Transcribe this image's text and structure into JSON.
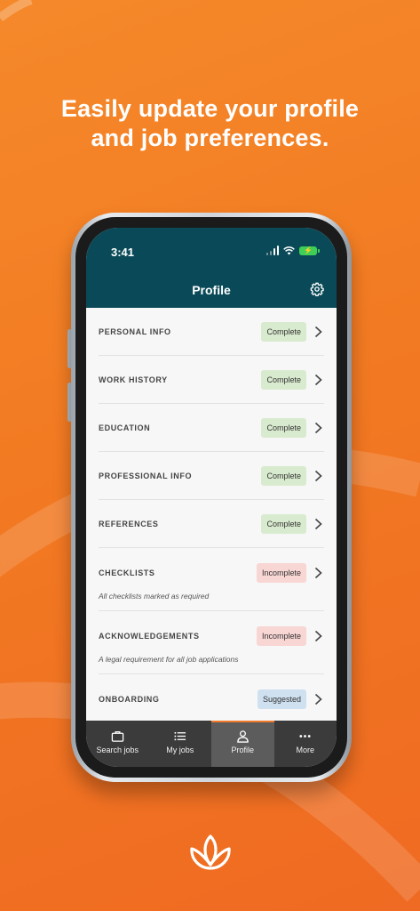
{
  "headline": {
    "line1": "Easily update your profile",
    "line2": "and job preferences."
  },
  "status_bar": {
    "time": "3:41"
  },
  "header": {
    "title": "Profile",
    "settings_icon": "gear-icon"
  },
  "profile_sections": [
    {
      "label": "PERSONAL INFO",
      "status": "Complete",
      "subtitle": ""
    },
    {
      "label": "WORK HISTORY",
      "status": "Complete",
      "subtitle": ""
    },
    {
      "label": "EDUCATION",
      "status": "Complete",
      "subtitle": ""
    },
    {
      "label": "PROFESSIONAL INFO",
      "status": "Complete",
      "subtitle": ""
    },
    {
      "label": "REFERENCES",
      "status": "Complete",
      "subtitle": ""
    },
    {
      "label": "CHECKLISTS",
      "status": "Incomplete",
      "subtitle": "All checklists marked as required"
    },
    {
      "label": "ACKNOWLEDGEMENTS",
      "status": "Incomplete",
      "subtitle": "A legal requirement for all job applications"
    },
    {
      "label": "ONBOARDING",
      "status": "Suggested",
      "subtitle": ""
    }
  ],
  "tabs": [
    {
      "label": "Search jobs",
      "icon": "briefcase-icon",
      "active": false
    },
    {
      "label": "My jobs",
      "icon": "list-icon",
      "active": false
    },
    {
      "label": "Profile",
      "icon": "person-icon",
      "active": true
    },
    {
      "label": "More",
      "icon": "more-dots-icon",
      "active": false
    }
  ],
  "colors": {
    "background_orange": "#f27a22",
    "header_teal": "#0a4a58",
    "badge_complete": "#d9ebcf",
    "badge_incomplete": "#f8d6d4",
    "badge_suggested": "#cfe1f1",
    "tabbar": "#3b3b3b",
    "tab_active_accent": "#f07a2a"
  },
  "brand_logo_icon": "lotus-logo-icon"
}
